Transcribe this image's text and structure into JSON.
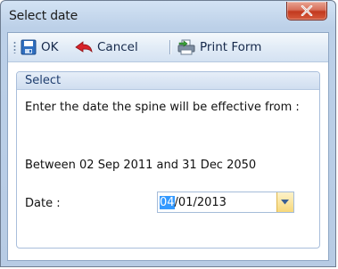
{
  "window": {
    "title": "Select date"
  },
  "toolbar": {
    "ok_label": "OK",
    "cancel_label": "Cancel",
    "print_label": "Print Form"
  },
  "group": {
    "header": "Select",
    "message": "Enter the date the spine will be effective from :",
    "range_text": "Between 02 Sep 2011 and 31 Dec 2050"
  },
  "date": {
    "label": "Date :",
    "value_selected": "04",
    "value_rest": "/01/2013"
  },
  "colors": {
    "selection": "#3399ff",
    "close_button": "#c2391f"
  },
  "icons": [
    "save-icon",
    "cancel-arrow-icon",
    "print-form-icon",
    "close-icon",
    "dropdown-arrow-icon"
  ]
}
